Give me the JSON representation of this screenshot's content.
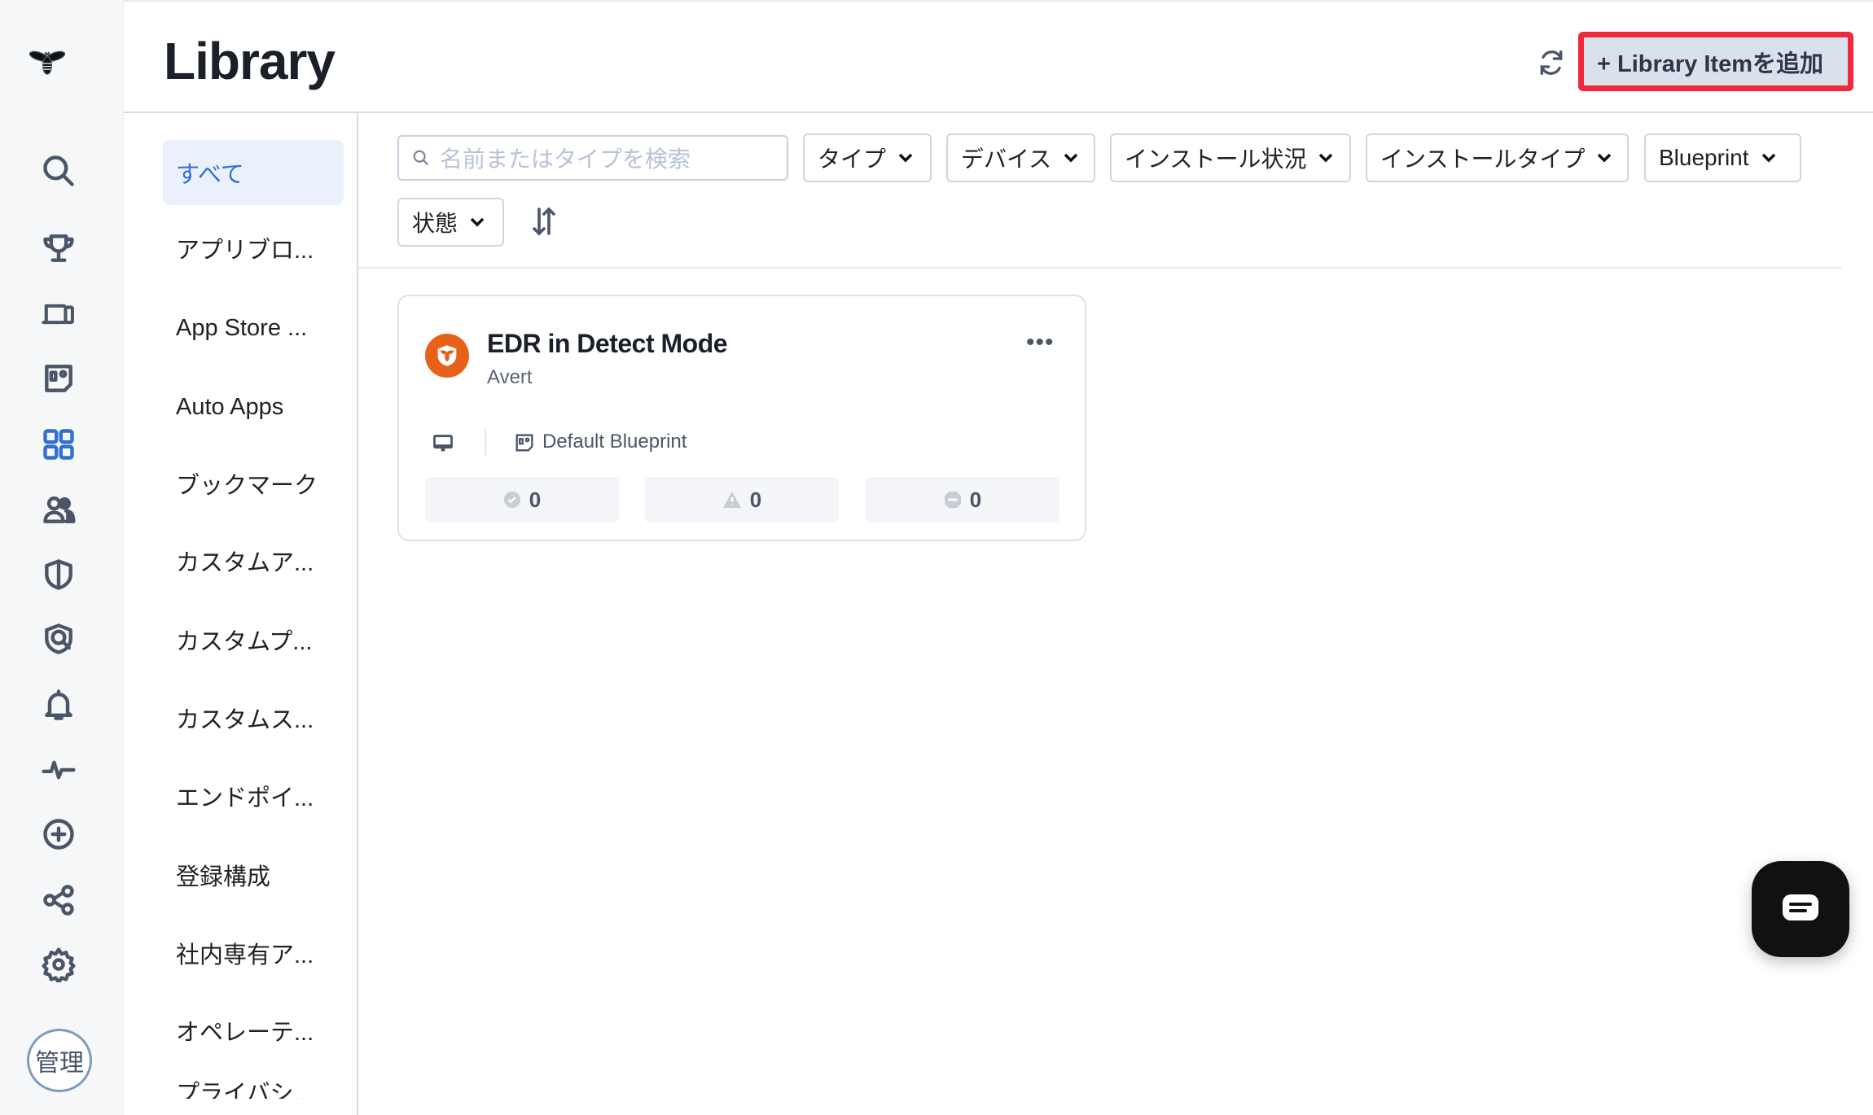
{
  "header": {
    "title": "Library",
    "add_button": "+ Library Itemを追加",
    "refresh_icon": "refresh-icon"
  },
  "rail": {
    "icons": [
      "search-icon",
      "trophy-icon",
      "devices-icon",
      "blueprint-icon",
      "library-grid-icon",
      "users-icon",
      "shield-icon",
      "threat-shield-icon",
      "bell-icon",
      "activity-icon",
      "add-circle-icon",
      "integrations-icon",
      "gear-icon"
    ],
    "active": "library-grid-icon",
    "admin_badge": "管理"
  },
  "subnav": {
    "items": [
      "すべて",
      "アプリブロ...",
      "App Store ...",
      "Auto Apps",
      "ブックマーク",
      "カスタムア...",
      "カスタムプ...",
      "カスタムス...",
      "エンドポイ...",
      "登録構成",
      "社内専有ア...",
      "オペレーテ...",
      "プライバシ..."
    ],
    "selected": "すべて"
  },
  "filters": {
    "search_placeholder": "名前またはタイプを検索",
    "dropdowns": [
      "タイプ",
      "デバイス",
      "インストール状況",
      "インストールタイプ",
      "Blueprint",
      "状態"
    ]
  },
  "card": {
    "title": "EDR in Detect Mode",
    "subtitle": "Avert",
    "blueprint": "Default Blueprint",
    "stats": {
      "success": "0",
      "warning": "0",
      "blocked": "0"
    }
  },
  "colors": {
    "accent": "#2f6fd6",
    "highlight": "#f0283c",
    "avert": "#e8611a"
  }
}
